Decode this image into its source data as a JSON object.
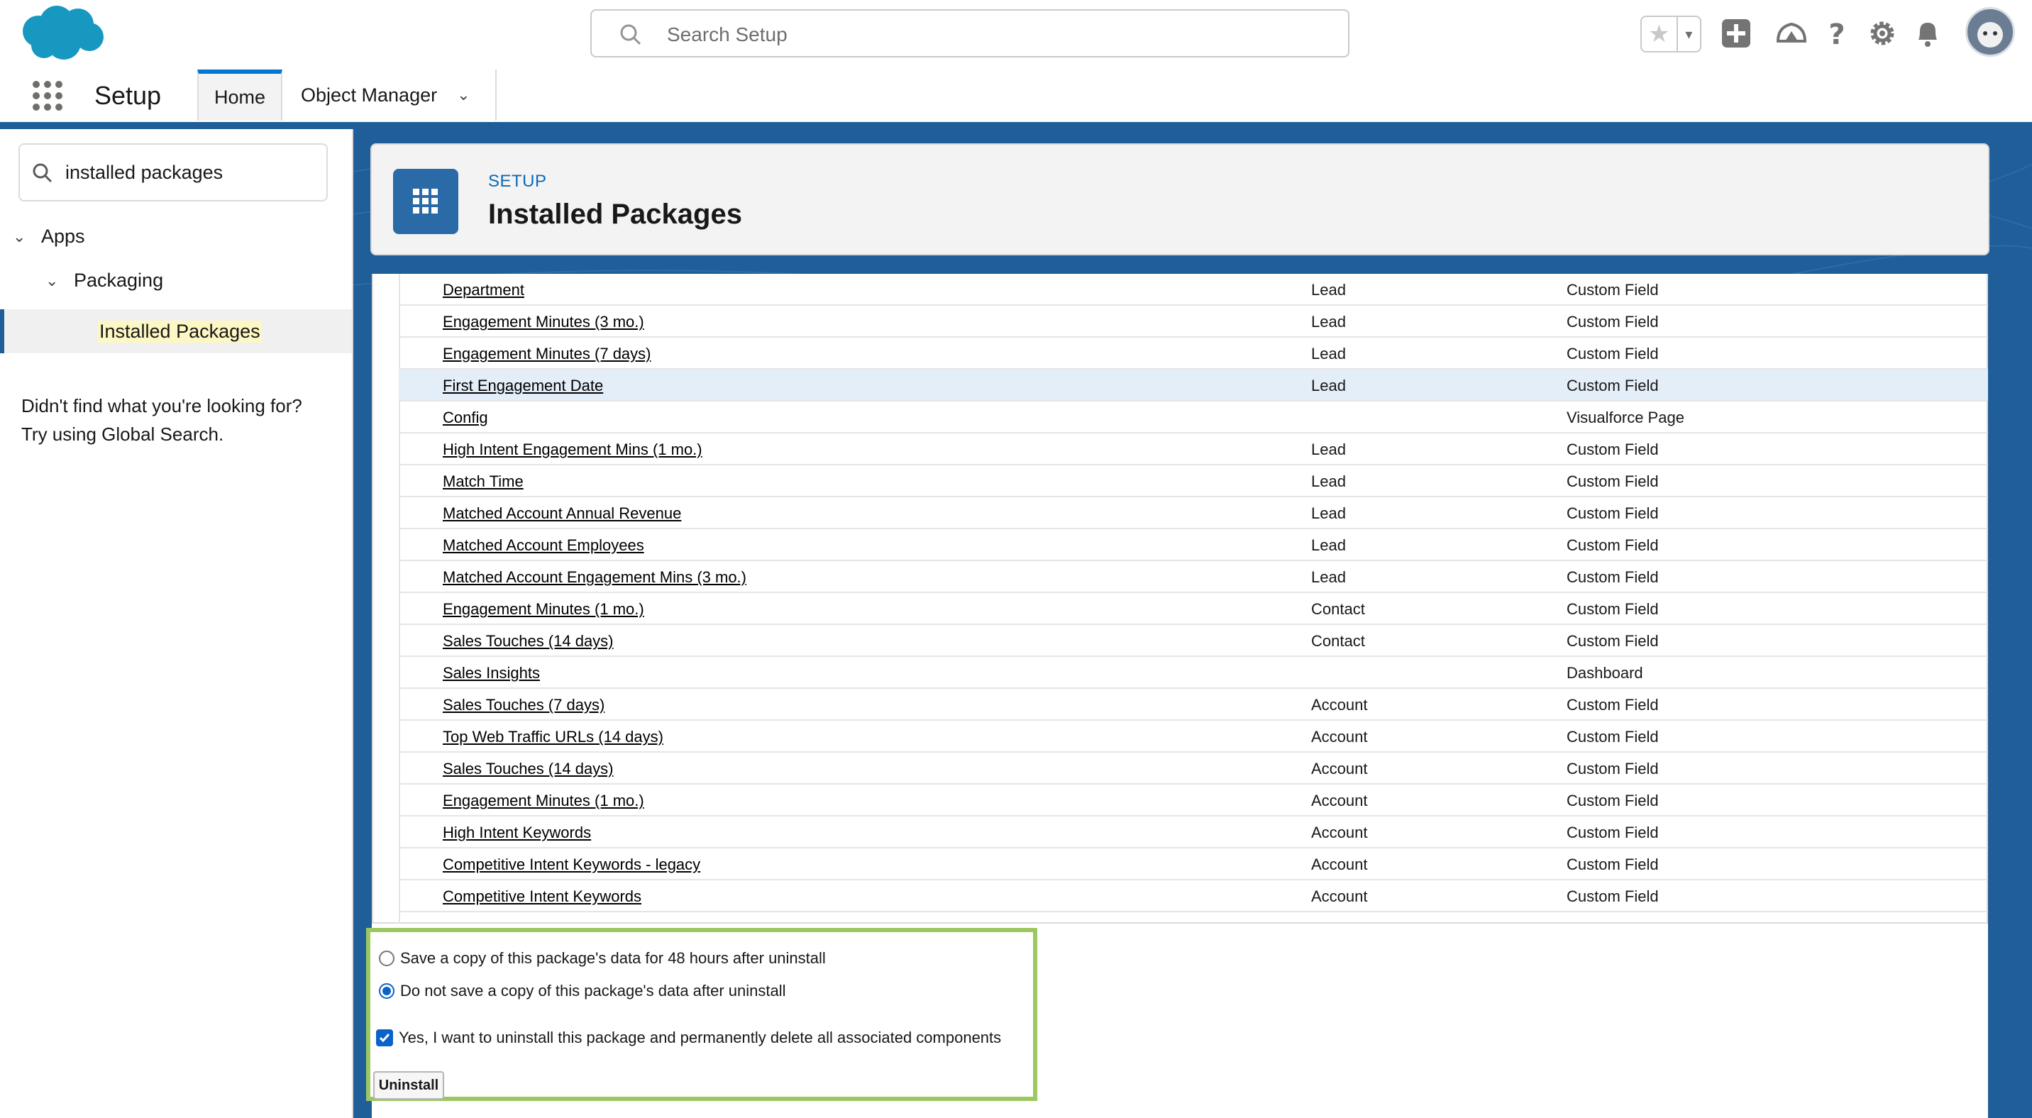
{
  "header": {
    "search_placeholder": "Search Setup",
    "icons": [
      "salesforce-cloud-logo",
      "search-icon",
      "star-icon",
      "chevron-down-icon",
      "add-icon",
      "trailhead-icon",
      "help-icon",
      "gear-icon",
      "bell-icon",
      "avatar"
    ]
  },
  "nav": {
    "app_name": "Setup",
    "tabs": [
      {
        "label": "Home",
        "active": true
      },
      {
        "label": "Object Manager",
        "has_menu": true
      }
    ]
  },
  "sidebar": {
    "quickfind_value": "installed packages",
    "tree": [
      {
        "label": "Apps",
        "level": 0
      },
      {
        "label": "Packaging",
        "level": 1
      },
      {
        "label": "Installed Packages",
        "level": 2,
        "selected": true
      }
    ],
    "not_found_line1": "Didn't find what you're looking for?",
    "not_found_line2": "Try using Global Search."
  },
  "page": {
    "breadcrumb": "SETUP",
    "title": "Installed Packages"
  },
  "components_table": {
    "rows": [
      {
        "name": "Department",
        "parent": "Lead",
        "type": "Custom Field"
      },
      {
        "name": "Engagement Minutes (3 mo.)",
        "parent": "Lead",
        "type": "Custom Field"
      },
      {
        "name": "Engagement Minutes (7 days)",
        "parent": "Lead",
        "type": "Custom Field"
      },
      {
        "name": "First Engagement Date",
        "parent": "Lead",
        "type": "Custom Field"
      },
      {
        "name": "Config",
        "parent": "",
        "type": "Visualforce Page"
      },
      {
        "name": "High Intent Engagement Mins (1 mo.)",
        "parent": "Lead",
        "type": "Custom Field"
      },
      {
        "name": "Match Time",
        "parent": "Lead",
        "type": "Custom Field"
      },
      {
        "name": "Matched Account Annual Revenue",
        "parent": "Lead",
        "type": "Custom Field"
      },
      {
        "name": "Matched Account Employees",
        "parent": "Lead",
        "type": "Custom Field"
      },
      {
        "name": "Matched Account Engagement Mins (3 mo.)",
        "parent": "Lead",
        "type": "Custom Field"
      },
      {
        "name": "Engagement Minutes (1 mo.)",
        "parent": "Contact",
        "type": "Custom Field"
      },
      {
        "name": "Sales Touches (14 days)",
        "parent": "Contact",
        "type": "Custom Field"
      },
      {
        "name": "Sales Insights",
        "parent": "",
        "type": "Dashboard"
      },
      {
        "name": "Sales Touches (7 days)",
        "parent": "Account",
        "type": "Custom Field"
      },
      {
        "name": "Top Web Traffic URLs (14 days)",
        "parent": "Account",
        "type": "Custom Field"
      },
      {
        "name": "Sales Touches (14 days)",
        "parent": "Account",
        "type": "Custom Field"
      },
      {
        "name": "Engagement Minutes (1 mo.)",
        "parent": "Account",
        "type": "Custom Field"
      },
      {
        "name": "High Intent Keywords",
        "parent": "Account",
        "type": "Custom Field"
      },
      {
        "name": "Competitive Intent Keywords - legacy",
        "parent": "Account",
        "type": "Custom Field"
      },
      {
        "name": "Competitive Intent Keywords",
        "parent": "Account",
        "type": "Custom Field"
      }
    ]
  },
  "uninstall": {
    "option_save": "Save a copy of this package's data for 48 hours after uninstall",
    "option_no_save": "Do not save a copy of this package's data after uninstall",
    "selected_option": "no_save",
    "confirm_label": "Yes, I want to uninstall this package and permanently delete all associated components",
    "confirm_checked": true,
    "button_label": "Uninstall"
  },
  "colors": {
    "brand_blue": "#1f5e99",
    "link_blue": "#0b6ab6",
    "highlight_green": "#9dc860",
    "row_hover": "#e4eef9"
  }
}
